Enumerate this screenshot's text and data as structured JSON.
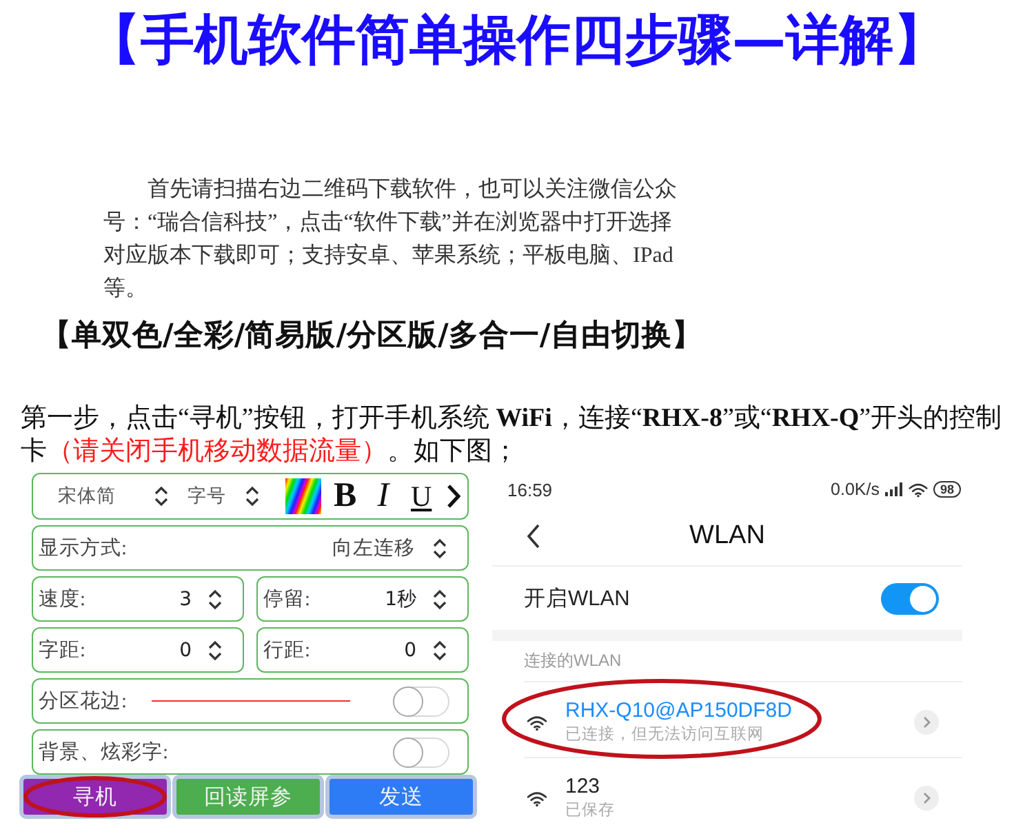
{
  "title": "【手机软件简单操作四步骤—详解】",
  "intro": "首先请扫描右边二维码下载软件，也可以关注微信公众号：“瑞合信科技”，点击“软件下载”并在浏览器中打开选择对应版本下载即可；支持安卓、苹果系统；平板电脑、IPad 等。",
  "versions": "【单双色/全彩/简易版/分区版/多合一/自由切换】",
  "step": {
    "text": "第一步，点击“寻机”按钮，打开手机系统 **WiFi**，连接“**RHX-8**”或“**RHX-Q**”开头的控制卡",
    "warning": "（请关闭手机移动数据流量）",
    "text_after": "。如下图；"
  },
  "app_panel": {
    "toolbar": {
      "font": "宋体简",
      "size": "字号",
      "format_buttons": [
        {
          "kind": "bold",
          "label": "B"
        },
        {
          "kind": "italic",
          "label": "I"
        },
        {
          "kind": "underline",
          "label": "U"
        }
      ]
    },
    "rows": [
      {
        "kind": "select",
        "label": "显示方式:",
        "value": "向左连移"
      },
      {
        "kind": "pair",
        "fields": [
          {
            "label": "速度:",
            "value": "3"
          },
          {
            "label": "停留:",
            "value": "1秒"
          }
        ]
      },
      {
        "kind": "pair",
        "fields": [
          {
            "label": "字距:",
            "value": "0"
          },
          {
            "label": "行距:",
            "value": "0"
          }
        ]
      },
      {
        "kind": "border",
        "label": "分区花边:",
        "on": false
      },
      {
        "kind": "toggle",
        "label": "背景、炫彩字:",
        "on": false
      }
    ],
    "buttons": [
      {
        "label": "寻机",
        "color": "#9227b0",
        "circled": true
      },
      {
        "label": "回读屏参",
        "color": "#4cae4f",
        "circled": false
      },
      {
        "label": "发送",
        "color": "#2d7cf6",
        "circled": false
      }
    ]
  },
  "phone_screen": {
    "status_bar": {
      "time": "16:59",
      "speed": "0.0K/s",
      "battery": "98"
    },
    "title": "WLAN",
    "wlan_toggle": {
      "label": "开启WLAN",
      "on": true
    },
    "section_label": "连接的WLAN",
    "networks": [
      {
        "name": "RHX-Q10@AP150DF8D",
        "status": "已连接，但无法访问互联网",
        "connected": true,
        "circled": true
      },
      {
        "name": "123",
        "status": "已保存",
        "connected": false,
        "circled": false
      }
    ]
  }
}
